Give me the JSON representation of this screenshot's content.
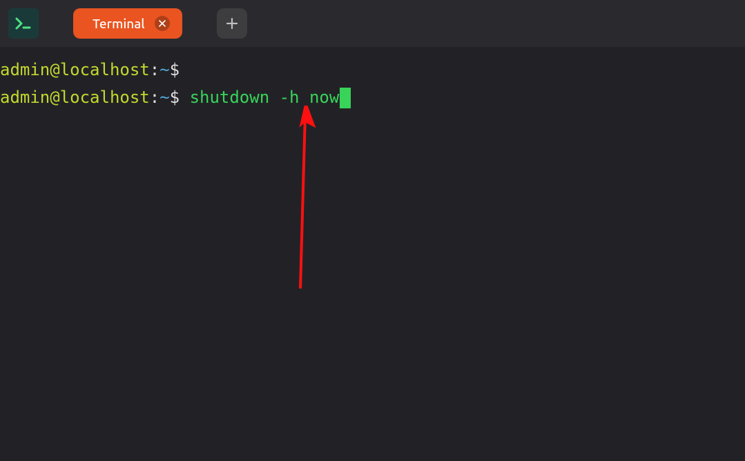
{
  "titlebar": {
    "tab": {
      "label": "Terminal"
    }
  },
  "terminal": {
    "lines": [
      {
        "userHost": "admin@localhost",
        "colon": ":",
        "path": "~",
        "prompt": "$ ",
        "command": "",
        "hasCursor": false
      },
      {
        "userHost": "admin@localhost",
        "colon": ":",
        "path": "~",
        "prompt": "$ ",
        "command": "shutdown -h now",
        "hasCursor": true
      }
    ]
  },
  "colors": {
    "accent": "#e95420",
    "userHost": "#c4d82e",
    "path": "#4fa6d9",
    "command": "#38d45a",
    "annotation": "#ff0000"
  }
}
